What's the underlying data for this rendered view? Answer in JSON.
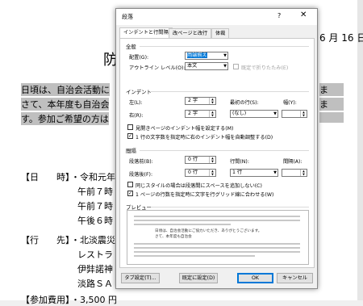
{
  "document": {
    "date_fragment": "6 月 16 日",
    "title_fragment": "防",
    "paragraph_lines": [
      "日頃は、自治会活動に",
      "さて、本年度も自治会",
      "す。参加ご希望の方は"
    ],
    "paragraph_right_fragments": [
      "ま",
      "ま"
    ],
    "rows": [
      {
        "label": "【日　　時】",
        "lines": [
          "・令和元年",
          "午前７時",
          "午前７時",
          "午後６時"
        ]
      },
      {
        "label": "【行　　先】",
        "lines": [
          "・北淡震災",
          "レストラ",
          "伊弉諾神",
          "淡路ＳＡ"
        ]
      },
      {
        "label": "【参加費用】",
        "lines": [
          "・3,500 円"
        ]
      }
    ]
  },
  "dialog": {
    "title": "段落",
    "help_label": "?",
    "close_label": "✕",
    "tabs": [
      "インデントと行間隔",
      "改ページと改行",
      "体裁"
    ],
    "general": {
      "heading": "全般",
      "alignment_label": "配置(G):",
      "alignment_value": "両端揃え",
      "outline_label": "アウトライン レベル(O):",
      "outline_value": "本文",
      "collapsed_label": "既定で折りたたみ(E)"
    },
    "indent": {
      "heading": "インデント",
      "left_label": "左(L):",
      "left_value": "2 字",
      "right_label": "右(R):",
      "right_value": "2 字",
      "first_line_label": "最初の行(S):",
      "first_line_value": "(なし)",
      "width_label": "幅(Y):",
      "mirror_label": "見開きページのインデント幅を設定する(M)",
      "auto_adjust_label": "1 行の文字数を指定時に右のインデント幅を自動調整する(D)"
    },
    "spacing": {
      "heading": "間隔",
      "before_label": "段落前(B):",
      "before_value": "0 行",
      "after_label": "段落後(F):",
      "after_value": "0 行",
      "line_spacing_label": "行間(N):",
      "line_spacing_value": "1 行",
      "at_label": "間隔(A):",
      "no_space_label": "同じスタイルの場合は段落間にスペースを追加しない(C)",
      "grid_label": "1 ページの行数を指定時に文字を行グリッド線に合わせる(W)"
    },
    "preview": {
      "heading": "プレビュー",
      "sample_lines": [
        "日頃は、自治会活動にご協力いただき、ありがとうございます。",
        "さて、本年度も自治会"
      ]
    },
    "buttons": {
      "tabs": "タブ設定(T)...",
      "default": "既定に設定(D)",
      "ok": "OK",
      "cancel": "キャンセル"
    }
  }
}
